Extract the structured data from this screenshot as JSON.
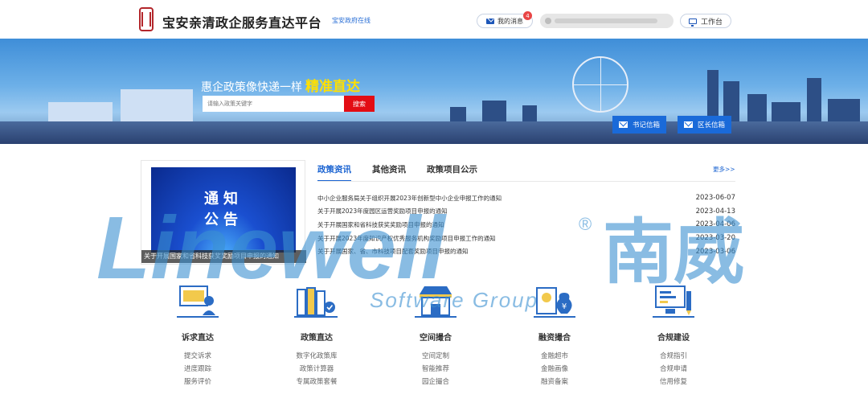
{
  "header": {
    "site_title": "宝安亲清政企服务直达平台",
    "gov_link": "宝安政府在线",
    "messages_label": "我的消息",
    "messages_count": "4",
    "workbench_label": "工作台"
  },
  "banner": {
    "slogan_prefix": "惠企政策像快递一样",
    "slogan_highlight": "精准直达",
    "search_placeholder": "请输入政策关键字",
    "search_button": "搜索",
    "mailbox_secretary": "书记信箱",
    "mailbox_mayor": "区长信箱"
  },
  "notice": {
    "image_line1": "通知",
    "image_line2": "公告",
    "caption": "关于开展国家和省科技获奖奖励项目申报的通知"
  },
  "news": {
    "tabs": [
      "政策资讯",
      "其他资讯",
      "政策项目公示"
    ],
    "more": "更多>>",
    "items": [
      {
        "title": "中小企业服务局关于组织开展2023年创新型中小企业申报工作的通知",
        "date": "2023-06-07"
      },
      {
        "title": "关于开展2023年度园区运营奖励项目申报的通知",
        "date": "2023-04-13"
      },
      {
        "title": "关于开展国家和省科技获奖奖励项目申报的通知",
        "date": "2023-04-06"
      },
      {
        "title": "关于开展2023年度知识产权优秀服务机构奖励项目申报工作的通知",
        "date": "2023-03-20"
      },
      {
        "title": "关于开展国家、省、市科技项目配套奖励项目申报的通知",
        "date": "2023-03-06"
      }
    ]
  },
  "features": [
    {
      "title": "诉求直达",
      "icon": "presentation-icon",
      "links": [
        "提交诉求",
        "进度跟踪",
        "服务评价"
      ]
    },
    {
      "title": "政策直达",
      "icon": "books-icon",
      "links": [
        "数字化政策库",
        "政策计算器",
        "专属政策套餐"
      ]
    },
    {
      "title": "空间撮合",
      "icon": "storefront-icon",
      "links": [
        "空间定制",
        "智能推荐",
        "园企撮合"
      ]
    },
    {
      "title": "融资撮合",
      "icon": "money-bag-icon",
      "links": [
        "金融超市",
        "金融画像",
        "融资备案"
      ]
    },
    {
      "title": "合规建设",
      "icon": "computer-check-icon",
      "links": [
        "合规指引",
        "合规申请",
        "信用修复"
      ]
    }
  ],
  "watermark": {
    "brand": "Linewell",
    "brand_cn": "南威",
    "tagline": "Software Group",
    "mark": "®"
  },
  "colors": {
    "brand_blue": "#1a63d1",
    "search_red": "#e30d14",
    "highlight_yellow": "#ffe000",
    "watermark_blue": "#3b8fd0"
  }
}
